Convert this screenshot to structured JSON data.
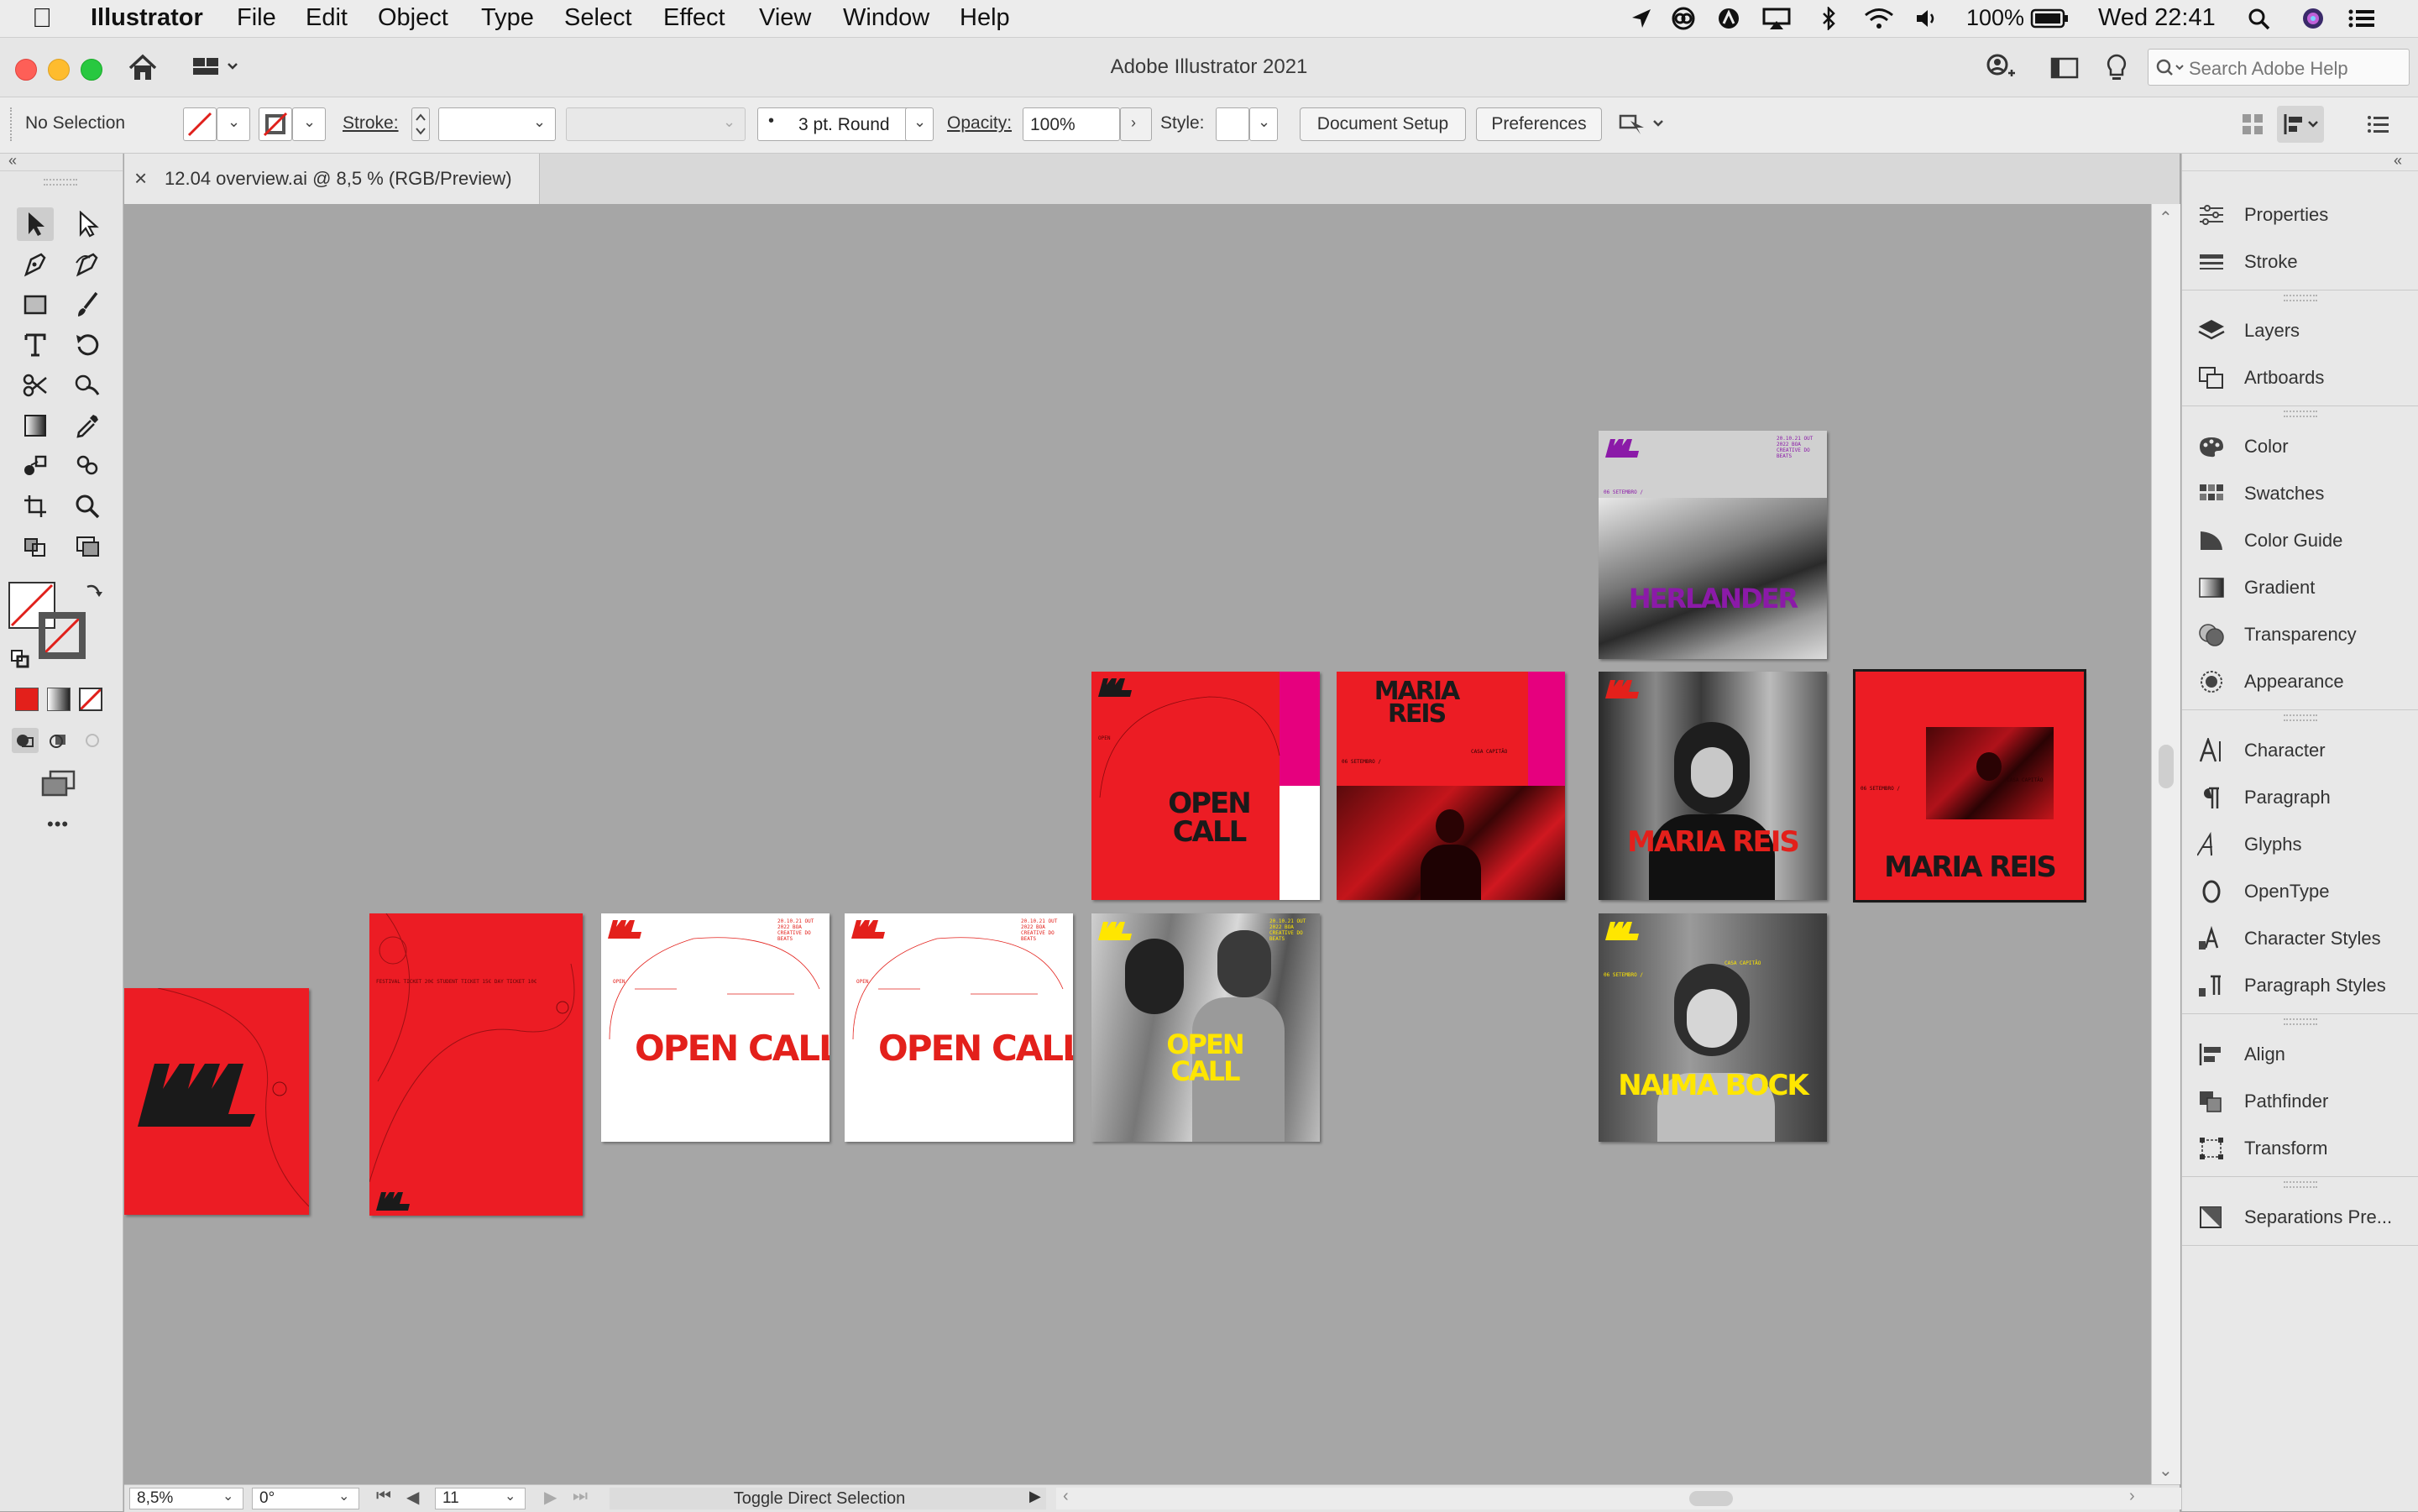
{
  "menubar": {
    "app_name": "Illustrator",
    "items": [
      "File",
      "Edit",
      "Object",
      "Type",
      "Select",
      "Effect",
      "View",
      "Window",
      "Help"
    ],
    "battery": "100%",
    "clock": "Wed 22:41"
  },
  "window": {
    "title": "Adobe Illustrator 2021",
    "search_placeholder": "Search Adobe Help"
  },
  "control_bar": {
    "selection": "No Selection",
    "stroke_label": "Stroke:",
    "brush": "3 pt. Round",
    "opacity_label": "Opacity:",
    "opacity_value": "100%",
    "style_label": "Style:",
    "document_setup": "Document Setup",
    "preferences": "Preferences"
  },
  "document_tab": {
    "close": "×",
    "title": "12.04 overview.ai @ 8,5 % (RGB/Preview)"
  },
  "toolbar": {
    "more": "•••"
  },
  "panels": {
    "groups": [
      [
        "Properties",
        "Stroke"
      ],
      [
        "Layers",
        "Artboards"
      ],
      [
        "Color",
        "Swatches",
        "Color Guide",
        "Gradient",
        "Transparency",
        "Appearance"
      ],
      [
        "Character",
        "Paragraph",
        "Glyphs",
        "OpenType",
        "Character Styles",
        "Paragraph Styles"
      ],
      [
        "Align",
        "Pathfinder",
        "Transform"
      ],
      [
        "Separations Pre..."
      ]
    ]
  },
  "artboards": {
    "herlander": "HERLANDER",
    "open_call": "OPEN CALL",
    "maria_reis": "MARIA REIS",
    "naima_bock": "NAIMA BOCK",
    "casa_capitao": "CASA CAPITÃO",
    "date_line": "06 SETEMBRO /",
    "poster_info": "20.10.21 OUT 2022 BOA CREATIVE DO BEATS",
    "open_line": "OPEN",
    "ticket_line": "FESTIVAL TICKET 20€ STUDENT TICKET 15€ DAY TICKET 10€"
  },
  "statusbar": {
    "zoom": "8,5%",
    "rotation": "0°",
    "artboard": "11",
    "status": "Toggle Direct Selection"
  },
  "colors": {
    "poster_red": "#ec1c24",
    "magenta": "#e6007e",
    "purple": "#8b1aa8",
    "yellow": "#ffe600",
    "canvas_gray": "#a6a6a6"
  }
}
